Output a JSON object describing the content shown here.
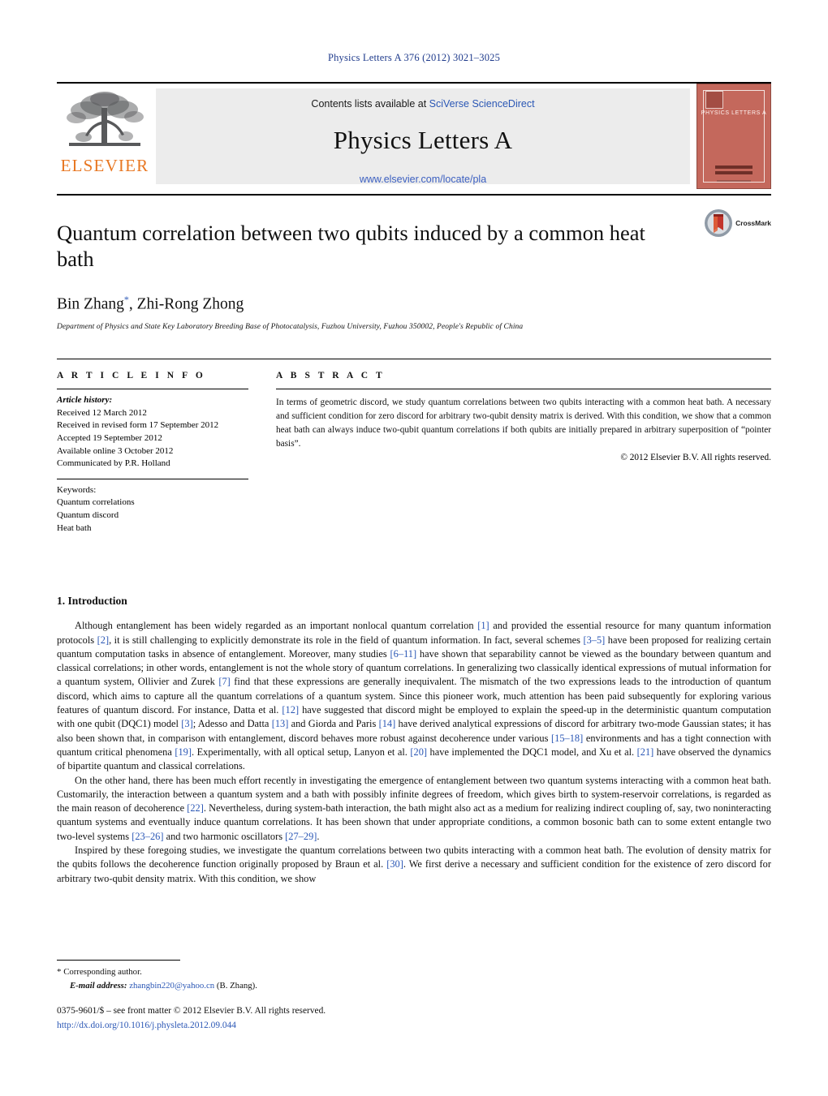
{
  "running_head": "Physics Letters A 376 (2012) 3021–3025",
  "masthead": {
    "publisher_name": "ELSEVIER",
    "contents_prefix": "Contents lists available at ",
    "contents_link": "SciVerse ScienceDirect",
    "journal_title": "Physics Letters A",
    "journal_url": "www.elsevier.com/locate/pla",
    "cover_title": "PHYSICS LETTERS A"
  },
  "article": {
    "title": "Quantum correlation between two qubits induced by a common heat bath",
    "authors": "Bin Zhang",
    "authors_marker": "*",
    "authors_rest": ", Zhi-Rong Zhong",
    "affiliation": "Department of Physics and State Key Laboratory Breeding Base of Photocatalysis, Fuzhou University, Fuzhou 350002, People's Republic of China",
    "crossmark_label": "CrossMark"
  },
  "info": {
    "heading": "A R T I C L E   I N F O",
    "history_label": "Article history:",
    "history": [
      "Received 12 March 2012",
      "Received in revised form 17 September 2012",
      "Accepted 19 September 2012",
      "Available online 3 October 2012",
      "Communicated by P.R. Holland"
    ],
    "keywords_label": "Keywords:",
    "keywords": [
      "Quantum correlations",
      "Quantum discord",
      "Heat bath"
    ]
  },
  "abstract": {
    "heading": "A B S T R A C T",
    "text": "In terms of geometric discord, we study quantum correlations between two qubits interacting with a common heat bath. A necessary and sufficient condition for zero discord for arbitrary two-qubit density matrix is derived. With this condition, we show that a common heat bath can always induce two-qubit quantum correlations if both qubits are initially prepared in arbitrary superposition of “pointer basis”.",
    "copyright": "© 2012 Elsevier B.V. All rights reserved."
  },
  "section": {
    "number_title": "1. Introduction",
    "paragraphs": [
      {
        "id": "p1",
        "runs": [
          {
            "t": "Although entanglement has been widely regarded as an important nonlocal quantum correlation "
          },
          {
            "t": "[1]",
            "cite": true
          },
          {
            "t": " and provided the essential resource for many quantum information protocols "
          },
          {
            "t": "[2]",
            "cite": true
          },
          {
            "t": ", it is still challenging to explicitly demonstrate its role in the field of quantum information. In fact, several schemes "
          },
          {
            "t": "[3–5]",
            "cite": true
          },
          {
            "t": " have been proposed for realizing certain quantum computation tasks in absence of entanglement. Moreover, many studies "
          },
          {
            "t": "[6–11]",
            "cite": true
          },
          {
            "t": " have shown that separability cannot be viewed as the boundary between quantum and classical correlations; in other words, entanglement is not the whole story of quantum correlations. In generalizing two classically identical expressions of mutual information for a quantum system, Ollivier and Zurek "
          },
          {
            "t": "[7]",
            "cite": true
          },
          {
            "t": " find that these expressions are generally inequivalent. The mismatch of the two expressions leads to the introduction of quantum discord, which aims to capture all the quantum correlations of a quantum system. Since this pioneer work, much attention has been paid subsequently for exploring various features of quantum discord. For instance, Datta et al. "
          },
          {
            "t": "[12]",
            "cite": true
          },
          {
            "t": " have suggested that discord might be employed to explain the speed-up in the deterministic quantum computation with one qubit (DQC1) model "
          },
          {
            "t": "[3]",
            "cite": true
          },
          {
            "t": "; Adesso and Datta "
          },
          {
            "t": "[13]",
            "cite": true
          },
          {
            "t": " and Giorda and Paris "
          },
          {
            "t": "[14]",
            "cite": true
          },
          {
            "t": " have derived analytical expressions of discord for arbitrary two-mode Gaussian states; it has also been shown that, in comparison with entanglement, discord behaves more robust against decoherence under various "
          },
          {
            "t": "[15–18]",
            "cite": true
          },
          {
            "t": " environments and has a tight connection with quantum critical phenomena "
          },
          {
            "t": "[19]",
            "cite": true
          },
          {
            "t": ". Experimentally, with all optical setup, Lanyon et al. "
          },
          {
            "t": "[20]",
            "cite": true
          },
          {
            "t": " have implemented the DQC1 model, and Xu et al. "
          },
          {
            "t": "[21]",
            "cite": true
          },
          {
            "t": " have observed the dynamics of bipartite quantum and classical correlations."
          }
        ]
      },
      {
        "id": "p2",
        "runs": [
          {
            "t": "On the other hand, there has been much effort recently in investigating the emergence of entanglement between two quantum systems interacting with a common heat bath. Customarily, the interaction between a quantum system and a bath with possibly infinite degrees of freedom, which gives birth to system-reservoir correlations, is regarded as the main reason of decoherence "
          },
          {
            "t": "[22]",
            "cite": true
          },
          {
            "t": ". Nevertheless, during system-bath interaction, the bath might also act as a medium for realizing indirect coupling of, say, two noninteracting quantum systems and eventually induce quantum correlations. It has been shown that under appropriate conditions, a common bosonic bath can to some extent entangle two two-level systems "
          },
          {
            "t": "[23–26]",
            "cite": true
          },
          {
            "t": " and two harmonic oscillators "
          },
          {
            "t": "[27–29]",
            "cite": true
          },
          {
            "t": "."
          }
        ]
      },
      {
        "id": "p3",
        "runs": [
          {
            "t": "Inspired by these foregoing studies, we investigate the quantum correlations between two qubits interacting with a common heat bath. The evolution of density matrix for the qubits follows the decoherence function originally proposed by Braun et al. "
          },
          {
            "t": "[30]",
            "cite": true
          },
          {
            "t": ". We first derive a necessary and sufficient condition for the existence of zero discord for arbitrary two-qubit density matrix. With this condition, we show"
          }
        ]
      }
    ]
  },
  "footer": {
    "corresponding_marker": "*",
    "corresponding_label": "Corresponding author.",
    "email_label": "E-mail address:",
    "email": "zhangbin220@yahoo.cn",
    "email_suffix": "(B. Zhang).",
    "issn_line": "0375-9601/$ – see front matter  © 2012 Elsevier B.V. All rights reserved.",
    "doi": "http://dx.doi.org/10.1016/j.physleta.2012.09.044"
  }
}
